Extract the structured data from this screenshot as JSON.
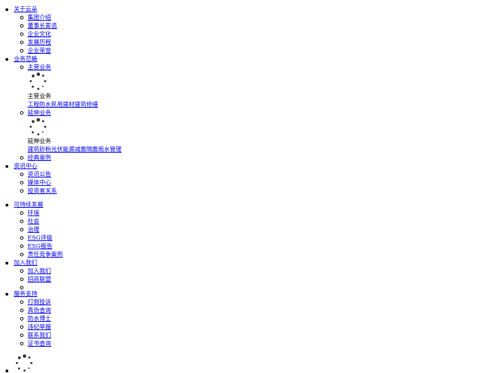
{
  "nav": {
    "about": {
      "label": "关于云朵",
      "items": [
        "集团介绍",
        "董事长寄语",
        "企业文化",
        "发展历程",
        "企业荣誉"
      ]
    },
    "business": {
      "label": "业务范畴",
      "main": {
        "link": "主营业务",
        "caption": "主营业务",
        "links": [
          "工程防水",
          "民用建材",
          "建筑修缮"
        ]
      },
      "extended": {
        "link": "延伸业务",
        "caption": "延伸业务",
        "links": [
          "建筑砂粉",
          "光伏能源",
          "减震隔震",
          "雨水管理"
        ]
      },
      "cases": "经典案例"
    },
    "news": {
      "label": "资讯中心",
      "items": [
        "资讯公告",
        "媒体中心",
        "投资者关系"
      ]
    },
    "sustain": {
      "label": "可持续发展",
      "items": [
        "环境",
        "社会",
        "治理",
        "ESG评级",
        "ESG报告",
        "责任竞争案例"
      ]
    },
    "join": {
      "label": "加入我们",
      "items": [
        "加入我们",
        "招商联盟"
      ]
    },
    "support": {
      "label": "服务支持",
      "items": [
        "打假投诉",
        "真伪查询",
        "防水博士",
        "违纪举报",
        "联系我们",
        "证书查询"
      ]
    }
  },
  "colors": {
    "link": "#0000ee",
    "text": "#000000",
    "spinner": "#333333"
  }
}
